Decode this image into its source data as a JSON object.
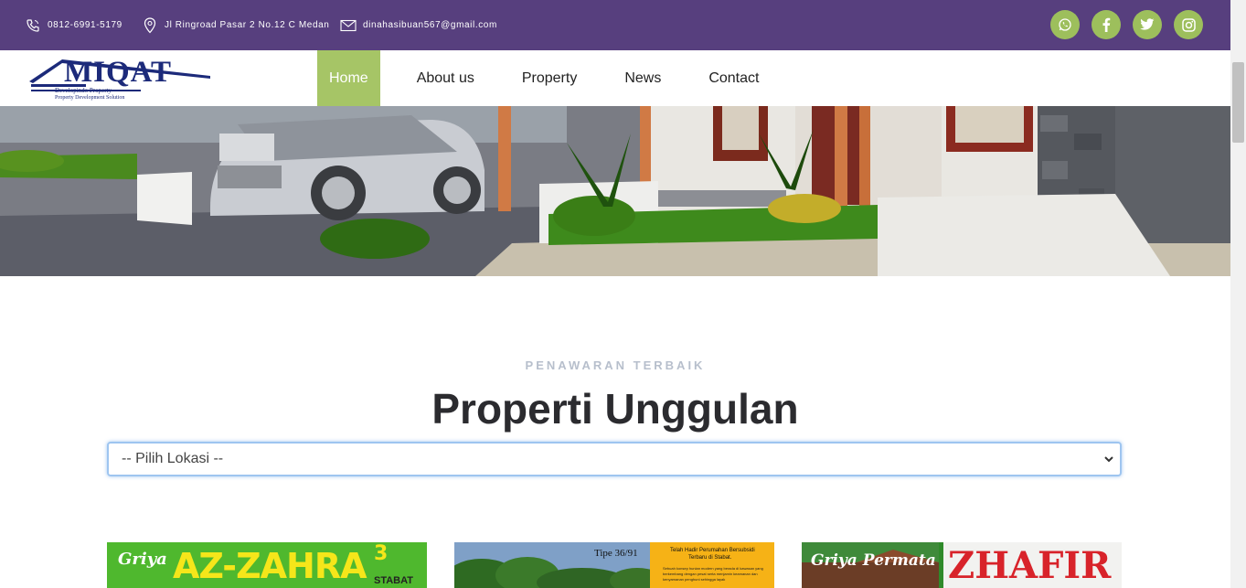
{
  "topbar": {
    "phone": "0812-6991-5179",
    "address": "Jl Ringroad Pasar 2 No.12 C Medan",
    "email": "dinahasibuan567@gmail.com",
    "socials": [
      {
        "icon": "whatsapp-icon",
        "glyph": "✆"
      },
      {
        "icon": "facebook-icon",
        "glyph": "f"
      },
      {
        "icon": "twitter-icon",
        "glyph": "t"
      },
      {
        "icon": "instagram-icon",
        "glyph": "◎"
      }
    ]
  },
  "logo": {
    "name": "MIQAT",
    "tagline": "Developindo Property",
    "subtitle": "Property Development Solution"
  },
  "nav": {
    "home": "Home",
    "about": "About us",
    "property": "Property",
    "news": "News",
    "contact": "Contact"
  },
  "section": {
    "kicker": "PENAWARAN TERBAIK",
    "title": "Properti Unggulan",
    "select_value": "-- Pilih Lokasi --"
  },
  "cards": {
    "card1": {
      "pre": "Griya",
      "title": "AZ-ZAHRA",
      "sup": "3",
      "sub": "STABAT"
    },
    "card2": {
      "tipe": "Tipe 36/91",
      "h1": "Telah Hadir Perumahan Bersubsidi",
      "h2": "Terbaru di Stabat.",
      "body": "Sebuah konsep hunian modern yang berada di kawasan yang berkembang dengan pesat serta menjamin keamanan dan kenyamanan penghuni sehingga layak"
    },
    "card3": {
      "pre": "Griya Permata",
      "title": "ZHAFIR"
    }
  },
  "colors": {
    "topbar": "#573f7e",
    "accent": "#a6c566",
    "social": "#9dbf5c"
  }
}
